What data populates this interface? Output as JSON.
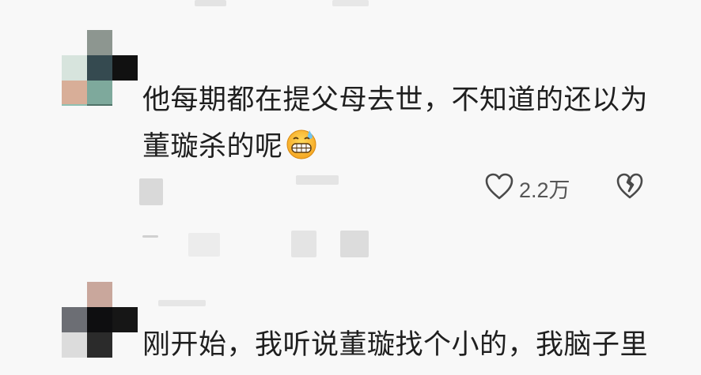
{
  "comments": [
    {
      "lines": [
        "他每期都在提父母去世，不知道的还以为",
        "董璇杀的呢"
      ],
      "emoji_icon": "grimacing-sweat-emoji-icon",
      "actions": {
        "like_icon": "heart-outline-icon",
        "like_count": "2.2万",
        "dislike_icon": "broken-heart-icon"
      }
    },
    {
      "lines": [
        "刚开始，我听说董璇找个小的，我脑子里"
      ]
    }
  ],
  "colors": {
    "text": "#1f1f1f",
    "meta": "#555555",
    "background": "#f8f8f8"
  }
}
